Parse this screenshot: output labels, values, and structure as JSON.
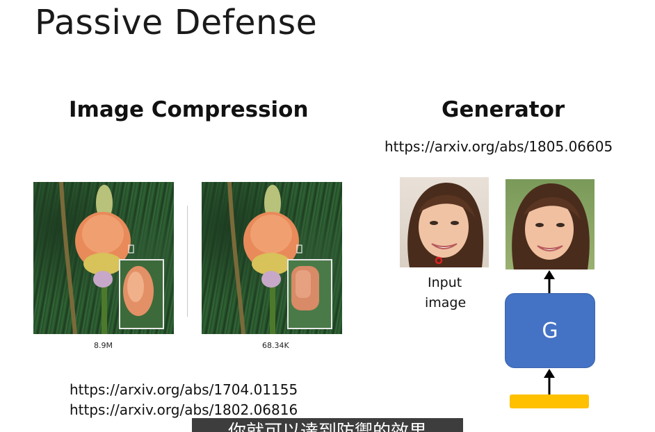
{
  "title": "Passive Defense",
  "left": {
    "heading": "Image Compression",
    "image_labels": [
      "8.9M",
      "68.34K"
    ],
    "urls": [
      "https://arxiv.org/abs/1704.01155",
      "https://arxiv.org/abs/1802.06816"
    ]
  },
  "right": {
    "heading": "Generator",
    "url": "https://arxiv.org/abs/1805.06605",
    "input_label_line1": "Input",
    "input_label_line2": "image",
    "generator_label": "G"
  },
  "subtitle": "你就可以達到防禦的效果",
  "colors": {
    "generator_box": "#4472c4",
    "noise_bar": "#ffc000",
    "perturbation_dot": "#e02020"
  }
}
